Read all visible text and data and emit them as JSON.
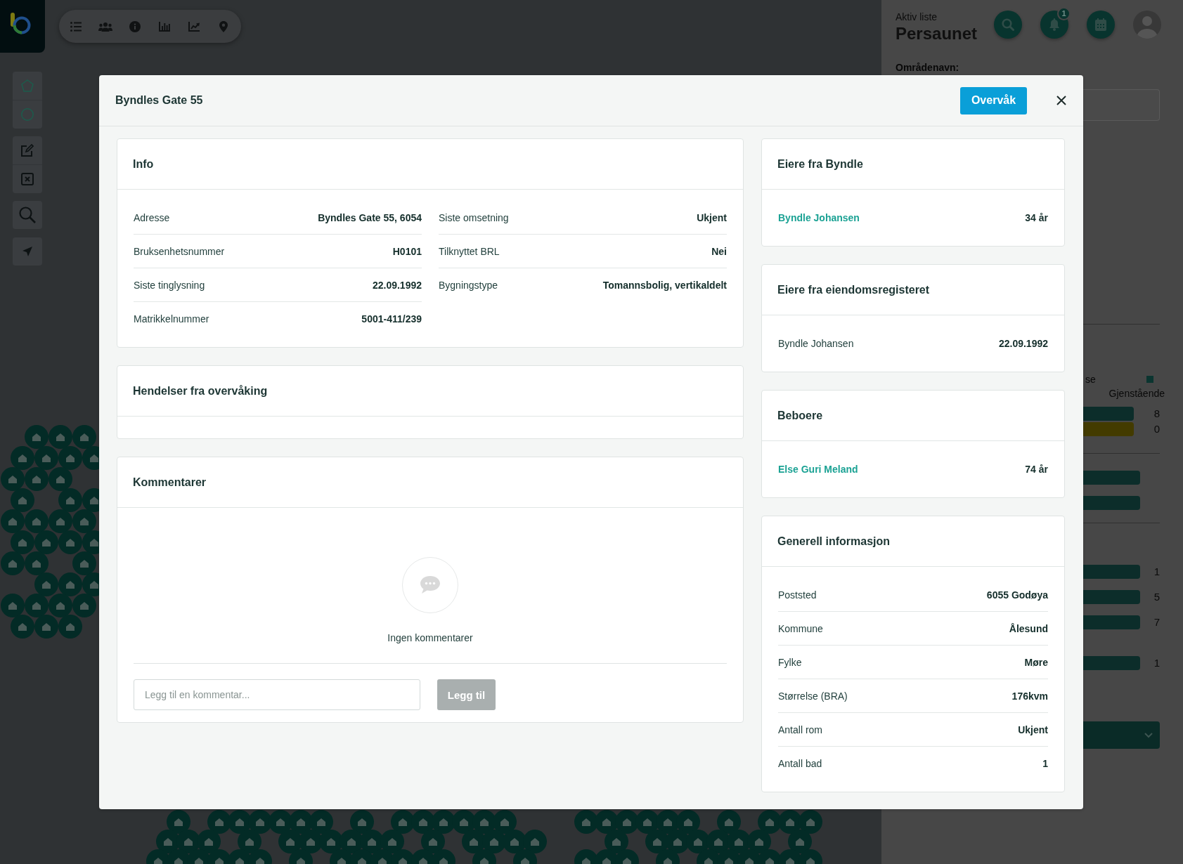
{
  "header": {
    "eyebrow": "Aktiv liste",
    "title": "Persaunet",
    "notification_count": "1"
  },
  "area": {
    "label": "Områdenavn:"
  },
  "stats": {
    "legend": [
      {
        "label": "se"
      },
      {
        "label": "Gjenstående",
        "color": "#0b3530"
      }
    ],
    "sections": [
      {
        "bars": [
          {
            "count": "8",
            "color": "#0c2d2a"
          },
          {
            "count": "0",
            "color": "#433b00"
          }
        ]
      },
      {
        "bars": [
          {
            "color": "#0c2d2a"
          },
          {
            "color": "#0c2d2a"
          }
        ]
      },
      {
        "bars": [
          {
            "count": "1",
            "color": "#0c2d2a"
          },
          {
            "count": "5",
            "color": "#0c2d2a"
          },
          {
            "count": "7",
            "color": "#0c2d2a"
          },
          {
            "count": "1",
            "color": "#0c2d2a"
          }
        ]
      }
    ]
  },
  "modal": {
    "title": "Byndles Gate 55",
    "watch_button": "Overvåk"
  },
  "info": {
    "title": "Info",
    "columns": [
      {
        "rows": [
          {
            "label": "Adresse",
            "value": "Byndles Gate 55, 6054"
          },
          {
            "label": "Bruksenhetsnummer",
            "value": "H0101"
          },
          {
            "label": "Siste tinglysning",
            "value": "22.09.1992"
          },
          {
            "label": "Matrikkelnummer",
            "value": "5001-411/239"
          }
        ]
      },
      {
        "rows": [
          {
            "label": "Siste omsetning",
            "value": "Ukjent"
          },
          {
            "label": "Tilknyttet BRL",
            "value": "Nei"
          },
          {
            "label": "Bygningstype",
            "value": "Tomannsbolig, vertikaldelt"
          }
        ]
      }
    ]
  },
  "events": {
    "title": "Hendelser fra overvåking"
  },
  "comments": {
    "title": "Kommentarer",
    "empty_text": "Ingen kommentarer",
    "input": {
      "placeholder": "Legg til en kommentar..."
    },
    "button": {
      "label": "Legg til",
      "disabled": true
    }
  },
  "side_cards": [
    {
      "title": "Eiere fra Byndle",
      "rows": [
        {
          "label": "Byndle Johansen",
          "value": "34 år",
          "link": true
        }
      ]
    },
    {
      "title": "Eiere fra eiendomsregisteret",
      "rows": [
        {
          "label": "Byndle Johansen",
          "value": "22.09.1992",
          "link": false
        }
      ]
    },
    {
      "title": "Beboere",
      "rows": [
        {
          "label": "Else Guri Meland",
          "value": "74 år",
          "link": true
        }
      ]
    },
    {
      "title": "Generell informasjon",
      "rows": [
        {
          "label": "Poststed",
          "value": "6055 Godøya",
          "link": false
        },
        {
          "label": "Kommune",
          "value": "Ålesund",
          "link": false
        },
        {
          "label": "Fylke",
          "value": "Møre",
          "link": false
        },
        {
          "label": "Størrelse (BRA)",
          "value": "176kvm",
          "link": false
        },
        {
          "label": "Antall rom",
          "value": "Ukjent",
          "link": false
        },
        {
          "label": "Antall bad",
          "value": "1",
          "link": false
        }
      ]
    }
  ]
}
